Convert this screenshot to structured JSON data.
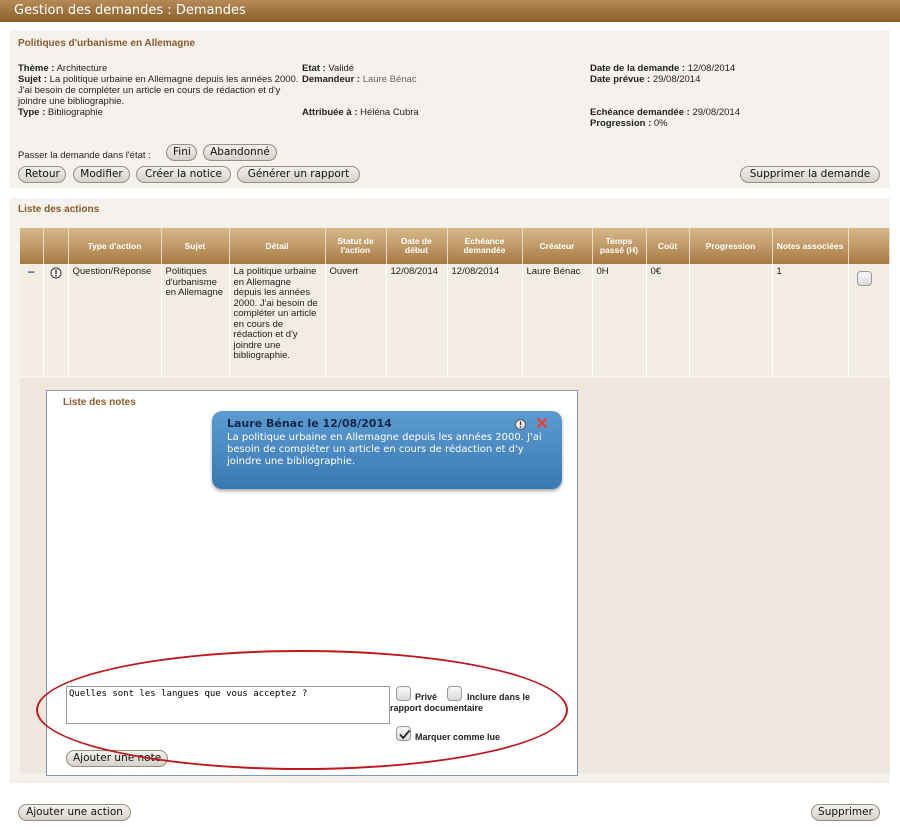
{
  "window_title": "Gestion des demandes : Demandes",
  "request": {
    "heading": "Politiques d'urbanisme en Allemagne",
    "theme_label": "Thème :",
    "theme": "Architecture",
    "subject_label": "Sujet :",
    "subject": "La politique urbaine en Allemagne depuis les années 2000. J'ai besoin de compléter un article en cours de rédaction et d'y joindre une bibliographie.",
    "type_label": "Type :",
    "type": "Bibliographie",
    "state_label": "Etat :",
    "state": "Validé",
    "requester_label": "Demandeur :",
    "requester": "Laure Bénac",
    "assigned_label": "Attribuée à :",
    "assigned": "Héléna Cubra",
    "request_date_label": "Date de la demande :",
    "request_date": "12/08/2014",
    "planned_date_label": "Date prévue :",
    "planned_date": "29/08/2014",
    "due_label": "Echéance demandée :",
    "due": "29/08/2014",
    "progress_label": "Progression :",
    "progress": "0%"
  },
  "state_change": {
    "label": "Passer la demande dans l'état :",
    "fini": "Fini",
    "abandonne": "Abandonné"
  },
  "buttons": {
    "retour": "Retour",
    "modifier": "Modifier",
    "creer_notice": "Créer la notice",
    "generer_rapport": "Générer un rapport",
    "supprimer_demande": "Supprimer la demande",
    "ajouter_action": "Ajouter une action",
    "supprimer": "Supprimer",
    "ajouter_note": "Ajouter une note"
  },
  "actions": {
    "title": "Liste des actions",
    "headers": [
      "Type d'action",
      "Sujet",
      "Détail",
      "Statut de l'action",
      "Date de début",
      "Echéance demandée",
      "Créateur",
      "Temps passé (H)",
      "Coût",
      "Progression",
      "Notes associées"
    ],
    "row": {
      "toggle": "−",
      "type": "Question/Réponse",
      "subject": "Politiques d'urbanisme en Allemagne",
      "detail": "La politique urbaine en Allemagne depuis les années 2000. J'ai besoin de compléter un article en cours de rédaction et d'y joindre une bibliographie.",
      "status": "Ouvert",
      "start": "12/08/2014",
      "due": "12/08/2014",
      "creator": "Laure Bénac",
      "time": "0H",
      "cost": "0€",
      "progress": "",
      "notes": "1"
    }
  },
  "notes": {
    "title": "Liste des notes",
    "bubble_author": "Laure Bénac le 12/08/2014",
    "bubble_text": "La politique urbaine en Allemagne depuis les années 2000. J'ai besoin de compléter un article en cours de rédaction et d'y joindre une bibliographie.",
    "input_value": "Quelles sont les langues que vous acceptez ?",
    "prive": "Privé",
    "inclure": "Inclure dans le rapport documentaire",
    "marquer": "Marquer comme lue",
    "marquer_checked": true
  },
  "colors": {
    "header_brown": "#8b5e2a",
    "title_brown": "#8b5a2b",
    "bubble_blue": "#3a78b3",
    "highlight_red": "#c0181a"
  }
}
